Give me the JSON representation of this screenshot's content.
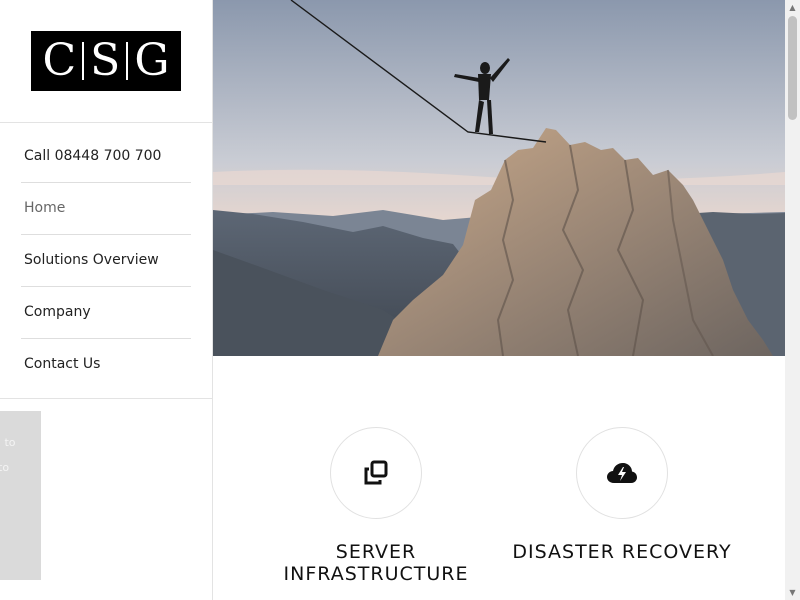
{
  "logo": {
    "letters": [
      "C",
      "S",
      "G"
    ]
  },
  "sidebar": {
    "items": [
      {
        "label": "Call 08448 700 700"
      },
      {
        "label": "Home",
        "active": true
      },
      {
        "label": "Solutions Overview"
      },
      {
        "label": "Company"
      },
      {
        "label": "Contact Us"
      }
    ]
  },
  "cookie_notice": {
    "line1": "g to",
    "line2": "to"
  },
  "hero": {
    "scene": "slackliner walking a line to a rocky mountain summit at dusk"
  },
  "services": [
    {
      "title_line1": "SERVER",
      "title_line2": "INFRASTRUCTURE",
      "icon": "copy-squares-icon"
    },
    {
      "title_line1": "DISASTER RECOVERY",
      "title_line2": "",
      "icon": "cloud-lightning-icon"
    }
  ],
  "scrollbar": {
    "up_glyph": "▲",
    "down_glyph": "▼"
  },
  "colors": {
    "accent": "#000000",
    "text": "#222222",
    "divider": "#dedede"
  }
}
